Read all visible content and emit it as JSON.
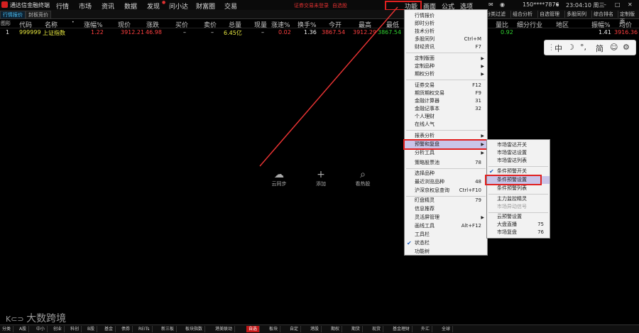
{
  "titlebar": {
    "app_name": "通达信金融终端",
    "menus": [
      "行情",
      "市场",
      "资讯",
      "数据",
      "发现",
      "问小达",
      "财富圈",
      "交易"
    ],
    "alert": "证券交易未登录",
    "self_select": "自选股",
    "right_menus": [
      "功能",
      "画面",
      "公式",
      "选项"
    ],
    "phone": "150****7876",
    "time": "23:04:10 周三"
  },
  "tabs": [
    "行情报价",
    "封板竞价"
  ],
  "right_tabs": [
    "分类过滤",
    "组合分析",
    "自选管理",
    "多股同列",
    "综合排名",
    "定制版面"
  ],
  "columns": [
    "图形",
    "代码",
    "名称",
    "涨幅%",
    "现价",
    "涨跌",
    "买价",
    "卖价",
    "总量",
    "现量",
    "涨速%",
    "换手%",
    "今开",
    "最高",
    "最低",
    "量比",
    "细分行业",
    "地区",
    "振幅%",
    "均价"
  ],
  "row": {
    "index": "1",
    "code": "999999",
    "name": "上证指数",
    "change_pct": "1.22",
    "price": "3912.21",
    "change": "46.98",
    "bid": "–",
    "ask": "–",
    "volume": "6.45亿",
    "cur_vol": "–",
    "speed": "0.02",
    "turnover": "1.36",
    "open": "3867.54",
    "high": "3912.29",
    "low": "3867.54",
    "vol_ratio": "0.92",
    "amplitude": "1.41",
    "avg_price": "3916.36"
  },
  "ime": {
    "ch": "中",
    "moon": "☽",
    "punct": "°,",
    "simp": "简",
    "emoji": "☺",
    "gear": "⚙",
    "grid": "⋮"
  },
  "center_actions": [
    {
      "label": "云同步",
      "icon": "☁"
    },
    {
      "label": "添加",
      "icon": "+"
    },
    {
      "label": "看热股",
      "icon": "⌕"
    }
  ],
  "function_menu": [
    {
      "label": "行情报价",
      "shortcut": "",
      "arrow": false
    },
    {
      "label": "即时分析",
      "shortcut": "",
      "arrow": false
    },
    {
      "label": "技术分析",
      "shortcut": "",
      "arrow": false
    },
    {
      "label": "多股同列",
      "shortcut": "Ctrl+M",
      "arrow": false
    },
    {
      "label": "财经资讯",
      "shortcut": "F7",
      "arrow": false
    },
    {
      "label": "定制版面",
      "shortcut": "",
      "arrow": true
    },
    {
      "label": "定制品种",
      "shortcut": "",
      "arrow": true
    },
    {
      "label": "期权分析",
      "shortcut": "",
      "arrow": true
    },
    {
      "label": "证券交易",
      "shortcut": "F12",
      "arrow": false
    },
    {
      "label": "期货期权交易",
      "shortcut": "F9",
      "arrow": false
    },
    {
      "label": "金融计算器",
      "shortcut": "31",
      "arrow": false
    },
    {
      "label": "金融记事本",
      "shortcut": "32",
      "arrow": false
    },
    {
      "label": "个人理财",
      "shortcut": "",
      "arrow": false
    },
    {
      "label": "在线人气",
      "shortcut": "",
      "arrow": false
    },
    {
      "label": "报表分析",
      "shortcut": "",
      "arrow": true
    },
    {
      "label": "预警和复盘",
      "shortcut": "",
      "arrow": true
    },
    {
      "label": "分析工具",
      "shortcut": "",
      "arrow": true
    },
    {
      "label": "策略股票池",
      "shortcut": "78",
      "arrow": false
    },
    {
      "label": "选择品种",
      "shortcut": "",
      "arrow": false
    },
    {
      "label": "最近浏览品种",
      "shortcut": "48",
      "arrow": false
    },
    {
      "label": "沪深京权息查询",
      "shortcut": "Ctrl+F10",
      "arrow": false
    },
    {
      "label": "盯盘精灵",
      "shortcut": "79",
      "arrow": false
    },
    {
      "label": "信息推荐",
      "shortcut": "",
      "arrow": false
    },
    {
      "label": "灵活屏管理",
      "shortcut": "",
      "arrow": true
    },
    {
      "label": "画线工具",
      "shortcut": "Alt+F12",
      "arrow": false
    },
    {
      "label": "工具栏",
      "shortcut": "",
      "arrow": false
    },
    {
      "label": "状态栏",
      "shortcut": "",
      "arrow": false
    },
    {
      "label": "功能树",
      "shortcut": "",
      "arrow": false
    }
  ],
  "submenu": [
    {
      "label": "市场雷达开关",
      "shortcut": ""
    },
    {
      "label": "市场雷达设置",
      "shortcut": ""
    },
    {
      "label": "市场雷达列表",
      "shortcut": ""
    },
    {
      "label": "条件预警开关",
      "shortcut": ""
    },
    {
      "label": "条件预警设置",
      "shortcut": ""
    },
    {
      "label": "条件预警列表",
      "shortcut": ""
    },
    {
      "label": "主力监控精灵",
      "shortcut": ""
    },
    {
      "label": "市场异动信号",
      "shortcut": ""
    },
    {
      "label": "云预警设置",
      "shortcut": ""
    },
    {
      "label": "大盘直播",
      "shortcut": "75"
    },
    {
      "label": "市场复盘",
      "shortcut": "76"
    }
  ],
  "watermark": "大数跨境",
  "bottom_tabs": [
    "分类",
    "A股",
    "中小",
    "创业",
    "科创",
    "B股",
    "基金",
    "债券",
    "REITs",
    "新三板",
    "板块指数",
    "港美联动",
    "自选",
    "板块",
    "自定",
    "港股",
    "期权",
    "期货",
    "现货",
    "基金理财",
    "外汇",
    "全球"
  ]
}
